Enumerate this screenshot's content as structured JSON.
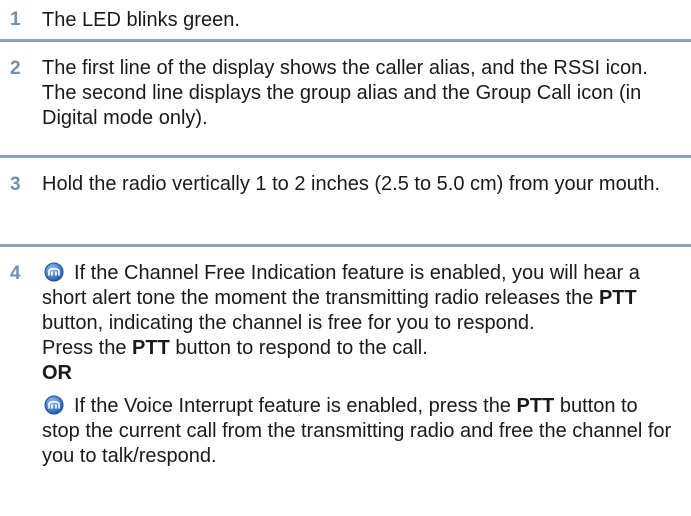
{
  "steps": [
    {
      "number": "1",
      "text": "The LED blinks green."
    },
    {
      "number": "2",
      "text": "The first line of the display shows the caller alias, and the RSSI icon. The second line displays the group alias and the Group Call icon (in Digital mode only)."
    },
    {
      "number": "3",
      "text": "Hold the radio vertically 1 to 2 inches (2.5 to 5.0 cm) from your mouth."
    },
    {
      "number": "4",
      "para1_before_ptt": "If the Channel Free Indication feature is enabled, you will hear a short alert tone the moment the transmitting radio releases the ",
      "ptt_label": "PTT",
      "para1_after_ptt": " button, indicating the channel is free for you to respond.",
      "press_before": "Press the ",
      "press_after": " button to respond to the call.",
      "or_label": "OR",
      "para2_before_ptt": "If the Voice Interrupt feature is enabled, press the ",
      "para2_after_ptt": " button to stop the current call from the transmitting radio and free the channel for you to talk/respond."
    }
  ],
  "icons": {
    "feature_icon": "feature-badge-icon",
    "feature_icon_color": "#2f6fc9"
  }
}
